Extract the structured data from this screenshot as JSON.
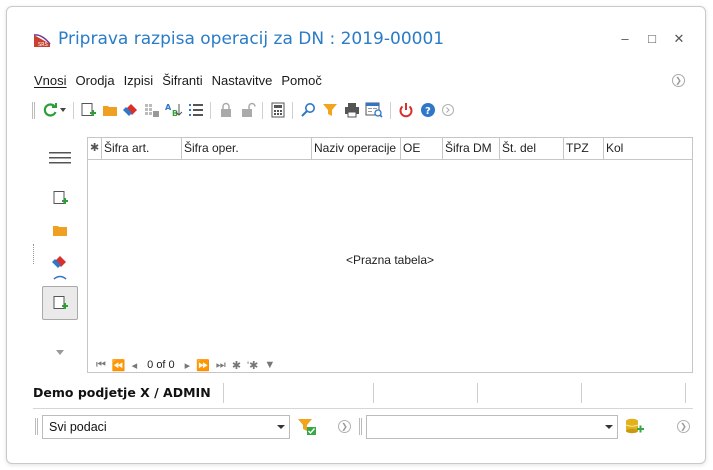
{
  "window": {
    "title": "Priprava razpisa operacij za DN : 2019-00001",
    "minimize": "–",
    "maximize": "□",
    "close": "✕"
  },
  "menu": [
    "Vnosi",
    "Orodja",
    "Izpisi",
    "Šifranti",
    "Nastavitve",
    "Pomoč"
  ],
  "grid": {
    "columns": [
      "Šifra art.",
      "Šifra oper.",
      "Naziv operacije",
      "OE",
      "Šifra DM",
      "Št. del",
      "TPZ",
      "Kol"
    ],
    "star_col": "✱",
    "empty_text": "<Prazna tabela>",
    "nav_position": "0 of 0"
  },
  "status": {
    "user": "Demo podjetje X / ADMIN"
  },
  "filter": {
    "selected": "Svi podaci",
    "second_selected": ""
  },
  "colors": {
    "title": "#2a7cc7",
    "refresh": "#2f9e38",
    "folder": "#f0a020",
    "power": "#d9302c",
    "help": "#2f77c9",
    "filter": "#f3a41d",
    "filter_check": "#38a846"
  }
}
